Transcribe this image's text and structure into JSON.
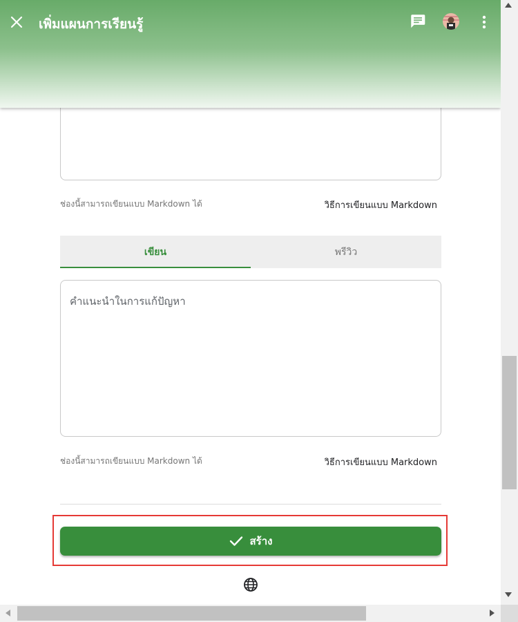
{
  "header": {
    "title": "เพิ่มแผนการเรียนรู้",
    "close_icon": "close-icon",
    "chat_icon": "chat-icon",
    "avatar_icon": "avatar",
    "more_icon": "more-vertical-icon"
  },
  "editor_top": {
    "value": "",
    "hint": "ช่องนี้สามารถเขียนแบบ Markdown ได้",
    "guide_link": "วิธีการเขียนแบบ Markdown"
  },
  "tabs": [
    {
      "label": "เขียน",
      "active": true
    },
    {
      "label": "พรีวิว",
      "active": false
    }
  ],
  "editor_main": {
    "placeholder": "คำแนะนำในการแก้ปัญหา",
    "value": "",
    "hint": "ช่องนี้สามารถเขียนแบบ Markdown ได้",
    "guide_link": "วิธีการเขียนแบบ Markdown"
  },
  "create_button": {
    "label": "สร้าง",
    "icon": "check-icon"
  },
  "footer": {
    "language_icon": "globe-icon"
  },
  "colors": {
    "primary": "#388e3c",
    "header_gradient_top": "#68ab69",
    "focus_ring": "#e53935"
  }
}
